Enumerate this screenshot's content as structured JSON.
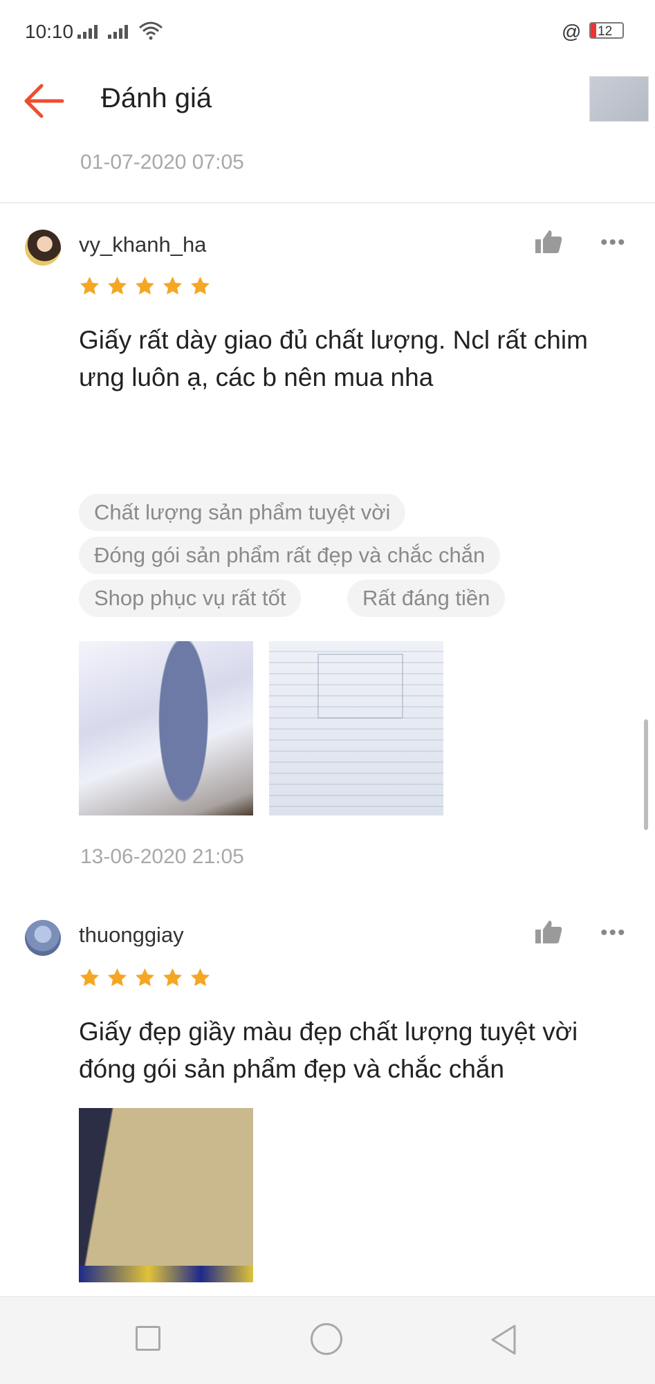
{
  "status_bar": {
    "time": "10:10",
    "battery": "12"
  },
  "header": {
    "title": "Đánh giá",
    "back_icon": "back-arrow-icon",
    "accent_color": "#ee4d2d"
  },
  "previous_review_date": "01-07-2020 07:05",
  "reviews": [
    {
      "username": "vy_khanh_ha",
      "rating": 5,
      "comment": "Giấy rất dày giao đủ chất lượng. Ncl rất chim ưng luôn ạ, các b nên mua nha",
      "tags": [
        "Chất lượng sản phẩm tuyệt vời",
        "Đóng gói sản phẩm rất đẹp và chắc chắn",
        "Shop phục vụ rất tốt",
        "Rất đáng tiền"
      ],
      "photo_count": 2,
      "date": "13-06-2020 21:05"
    },
    {
      "username": "thuonggiay",
      "rating": 5,
      "comment": "Giấy đẹp giầy màu đẹp chất lượng tuyệt vời đóng gói sản phẩm đẹp và chắc chắn",
      "photo_count": 1
    }
  ],
  "star_color": "#f5a623",
  "icons": {
    "like": "thumbs-up-icon",
    "more": "more-dots-icon"
  },
  "more_glyph": "•••"
}
